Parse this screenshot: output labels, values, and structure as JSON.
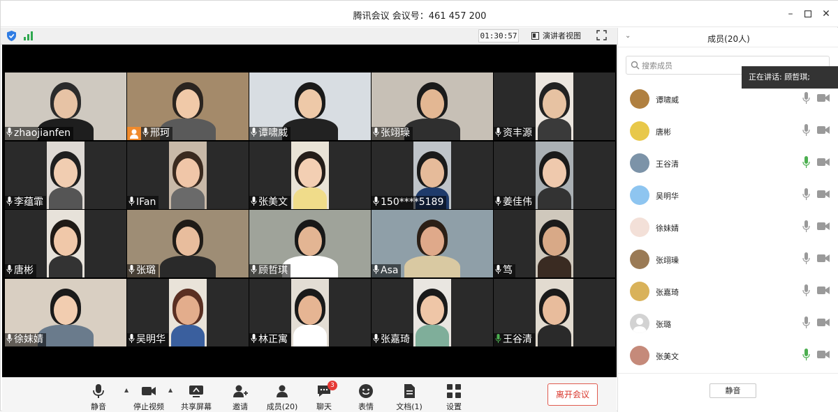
{
  "window": {
    "title": "腾讯会议 会议号：461 457 200"
  },
  "topbar": {
    "timer": "01:30:57",
    "view_label": "演讲者视图"
  },
  "tiles": [
    {
      "name": "zhaojianfen"
    },
    {
      "name": "邢珂"
    },
    {
      "name": "谭啸威"
    },
    {
      "name": "张翊璪"
    },
    {
      "name": "资丰源"
    },
    {
      "name": "李蕴霏"
    },
    {
      "name": "IFan"
    },
    {
      "name": "张美文"
    },
    {
      "name": "150****5189"
    },
    {
      "name": "姜佳伟"
    },
    {
      "name": "唐彬"
    },
    {
      "name": "张璐"
    },
    {
      "name": "顾哲琪"
    },
    {
      "name": "Asa"
    },
    {
      "name": "笃"
    },
    {
      "name": "徐妹婧"
    },
    {
      "name": "吴明华"
    },
    {
      "name": "林正寓"
    },
    {
      "name": "张嘉琦"
    },
    {
      "name": "王谷清"
    }
  ],
  "bottombar": {
    "mute": "静音",
    "stop_video": "停止视频",
    "share_screen": "共享屏幕",
    "invite": "邀请",
    "members": "成员(20)",
    "chat": "聊天",
    "chat_badge": "3",
    "reactions": "表情",
    "docs": "文档(1)",
    "settings": "设置",
    "leave": "离开会议"
  },
  "panel": {
    "title": "成员(20人)",
    "search_placeholder": "搜索成员",
    "speaking": "正在讲话: 顾哲琪;",
    "members": [
      {
        "name": "谭啸威",
        "mic": "#9a9a9a"
      },
      {
        "name": "唐彬",
        "mic": "#9a9a9a"
      },
      {
        "name": "王谷清",
        "mic": "#4caf50"
      },
      {
        "name": "吴明华",
        "mic": "#9a9a9a"
      },
      {
        "name": "徐妹婧",
        "mic": "#9a9a9a"
      },
      {
        "name": "张翊璪",
        "mic": "#9a9a9a"
      },
      {
        "name": "张嘉琦",
        "mic": "#9a9a9a"
      },
      {
        "name": "张璐",
        "mic": "#9a9a9a"
      },
      {
        "name": "张美文",
        "mic": "#4caf50"
      }
    ],
    "mute_all": "静音"
  }
}
